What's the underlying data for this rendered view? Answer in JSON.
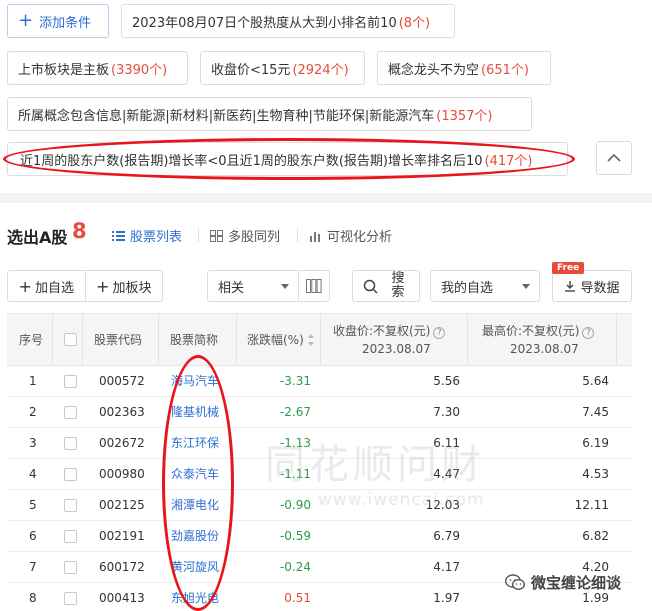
{
  "conditions": {
    "add_label": "添加条件",
    "items": [
      {
        "text": "2023年08月07日个股热度从大到小排名前10",
        "count": "(8个)"
      },
      {
        "text": "上市板块是主板",
        "count": "(3390个)"
      },
      {
        "text": "收盘价<15元",
        "count": "(2924个)"
      },
      {
        "text": "概念龙头不为空",
        "count": "(651个)"
      },
      {
        "text": "所属概念包含信息|新能源|新材料|新医药|生物育种|节能环保|新能源汽车",
        "count": "(1357个)"
      },
      {
        "text": "近1周的股东户数(报告期)增长率<0且近1周的股东户数(报告期)增长率排名后10",
        "count": "(417个)"
      }
    ]
  },
  "results": {
    "title": "选出A股",
    "count": "8",
    "tabs": [
      "股票列表",
      "多股同列",
      "可视化分析"
    ]
  },
  "toolbar": {
    "add_watchlist": "加自选",
    "add_sector": "加板块",
    "sort_select": "相关",
    "search": "搜索",
    "my_watchlist": "我的自选",
    "free_badge": "Free",
    "export": "导数据"
  },
  "table": {
    "headers": {
      "index": "序号",
      "code": "股票代码",
      "name": "股票简称",
      "change": "涨跌幅(%)",
      "close": "收盘价:不复权(元)",
      "high": "最高价:不复权(元)",
      "date": "2023.08.07"
    },
    "rows": [
      {
        "idx": "1",
        "code": "000572",
        "name": "海马汽车",
        "change": "-3.31",
        "close": "5.56",
        "high": "5.64"
      },
      {
        "idx": "2",
        "code": "002363",
        "name": "隆基机械",
        "change": "-2.67",
        "close": "7.30",
        "high": "7.45"
      },
      {
        "idx": "3",
        "code": "002672",
        "name": "东江环保",
        "change": "-1.13",
        "close": "6.11",
        "high": "6.19"
      },
      {
        "idx": "4",
        "code": "000980",
        "name": "众泰汽车",
        "change": "-1.11",
        "close": "4.47",
        "high": "4.53"
      },
      {
        "idx": "5",
        "code": "002125",
        "name": "湘潭电化",
        "change": "-0.90",
        "close": "12.03",
        "high": "12.11"
      },
      {
        "idx": "6",
        "code": "002191",
        "name": "劲嘉股份",
        "change": "-0.59",
        "close": "6.79",
        "high": "6.82"
      },
      {
        "idx": "7",
        "code": "600172",
        "name": "黄河旋风",
        "change": "-0.24",
        "close": "4.17",
        "high": "4.20"
      },
      {
        "idx": "8",
        "code": "000413",
        "name": "东旭光电",
        "change": "0.51",
        "close": "1.97",
        "high": "1.99"
      }
    ]
  },
  "watermark": {
    "cn": "同花顺问财",
    "en": "www.iwencai.com"
  },
  "wechat_label": "微宝缠论细谈",
  "colors": {
    "accent": "#2f6fd6",
    "up": "#e64b3c",
    "down": "#2e9b4a",
    "highlight": "#e8151b"
  }
}
